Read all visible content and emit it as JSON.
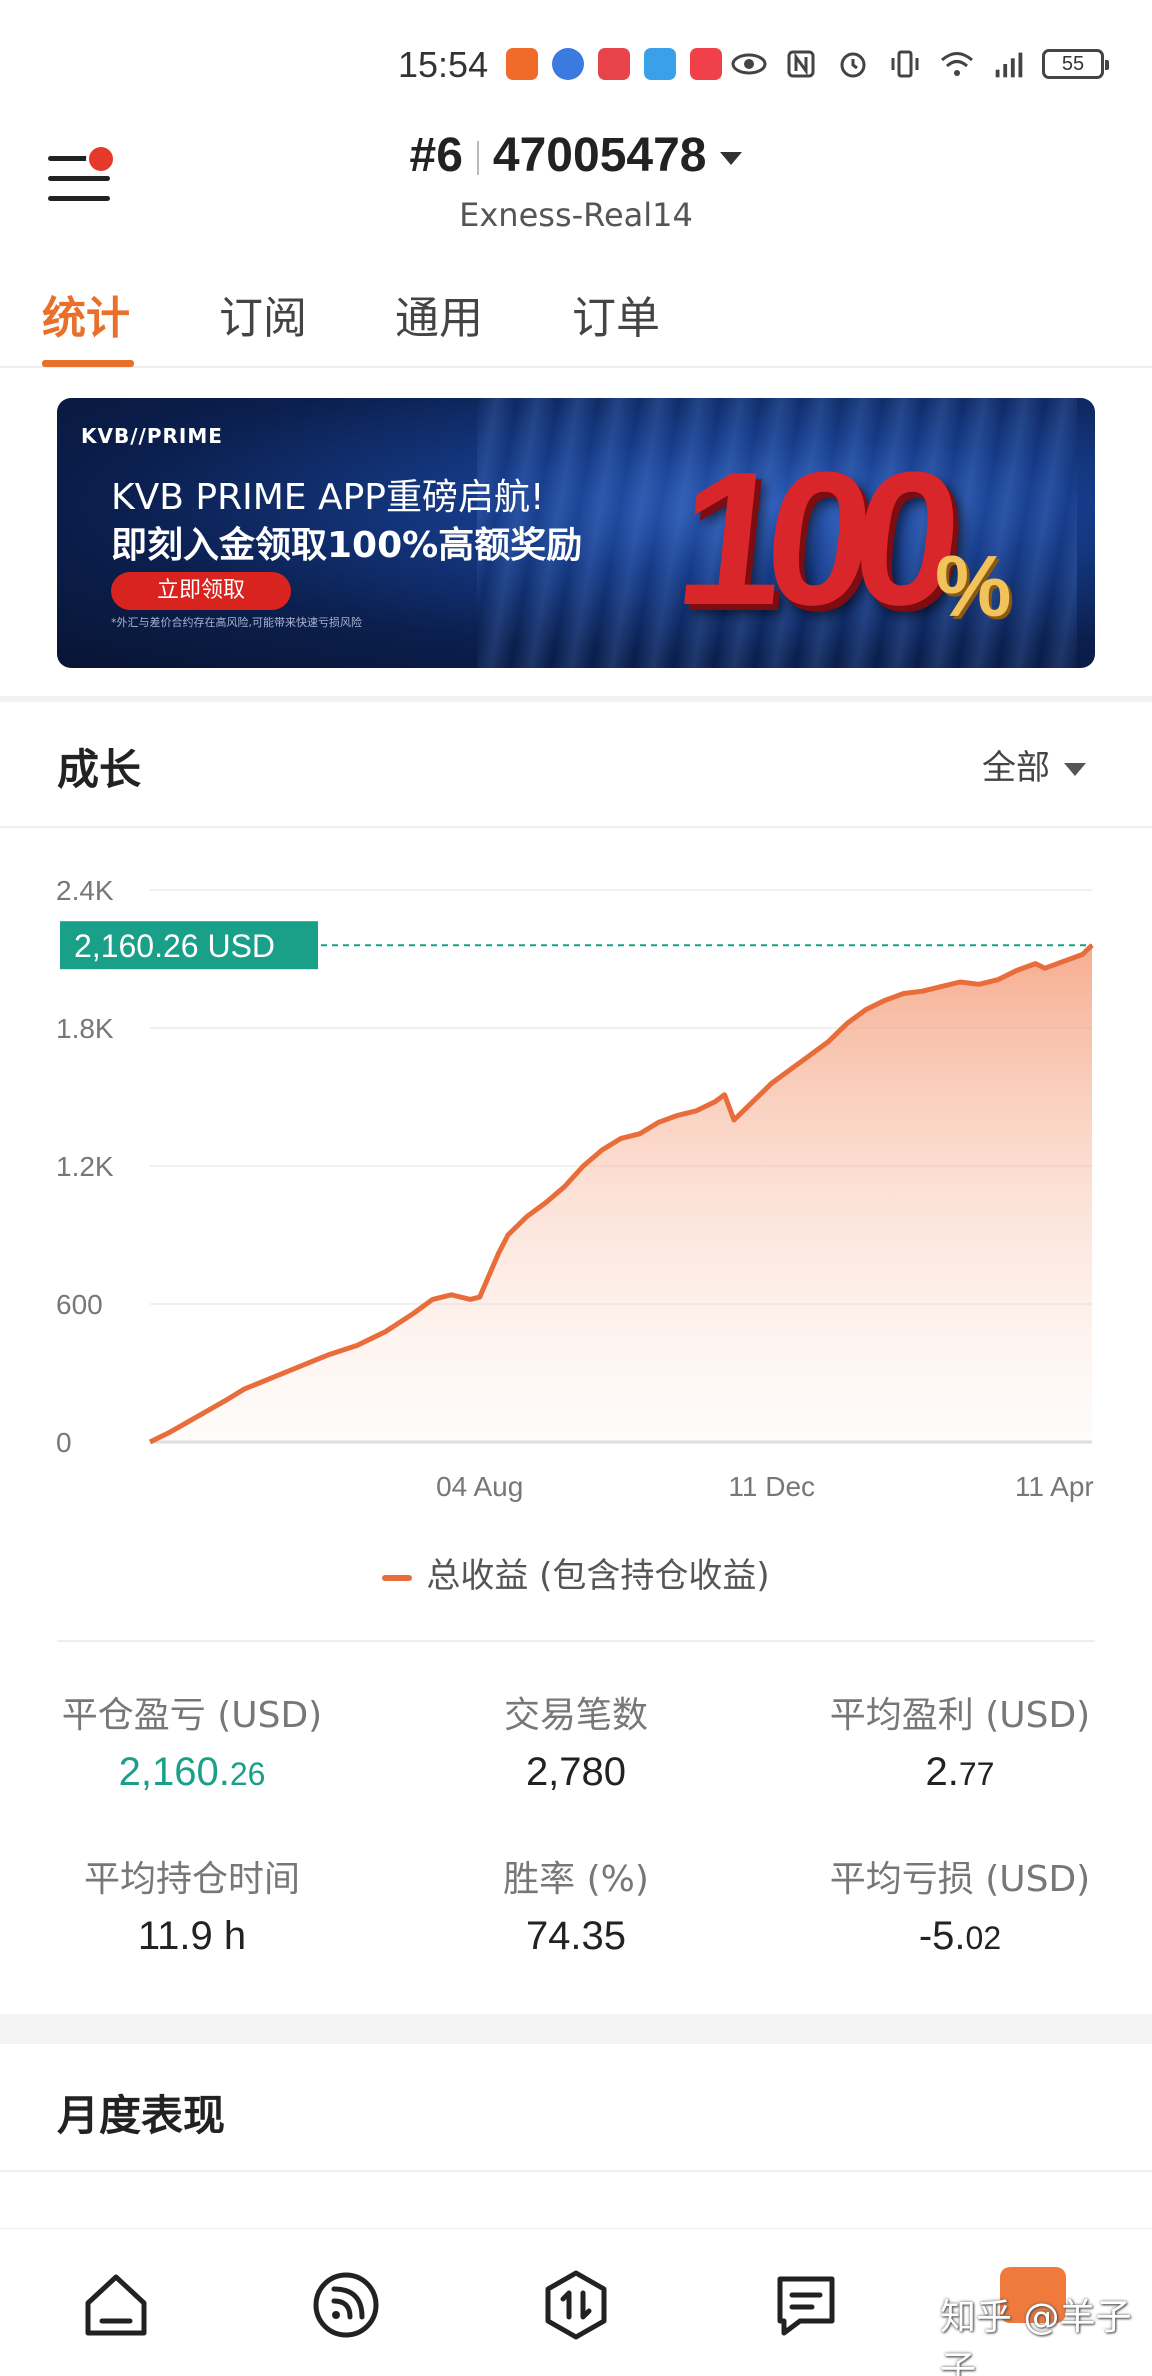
{
  "status_bar": {
    "time": "15:54",
    "battery": "55",
    "icons": [
      "app-notify-orange",
      "app-blue",
      "app-huawei",
      "app-weather",
      "app-red",
      "eye-icon",
      "nfc-icon",
      "alarm-icon",
      "vibrate-icon",
      "wifi-icon",
      "signal-5g-icon"
    ]
  },
  "header": {
    "rank": "#6",
    "account": "47005478",
    "server": "Exness-Real14"
  },
  "tabs": [
    {
      "label": "统计",
      "active": true
    },
    {
      "label": "订阅",
      "active": false
    },
    {
      "label": "通用",
      "active": false
    },
    {
      "label": "订单",
      "active": false
    }
  ],
  "banner": {
    "logo": "KVB//PRIME",
    "line1": "KVB PRIME APP重磅启航!",
    "line2": "即刻入金领取100%高额奖励",
    "cta": "立即领取",
    "disclaimer": "*外汇与差价合约存在高风险,可能带来快速亏损风险",
    "big_number": "100",
    "percent": "%"
  },
  "growth": {
    "title": "成长",
    "range_label": "全部",
    "current_value_label": "2,160.26 USD",
    "legend": "总收益 (包含持仓收益)"
  },
  "chart_data": {
    "type": "area",
    "ylim": [
      0,
      2400
    ],
    "yticks": [
      "0",
      "600",
      "1.2K",
      "1.8K",
      "2.4K"
    ],
    "ytick_values": [
      0,
      600,
      1200,
      1800,
      2400
    ],
    "xticks": [
      "04 Aug",
      "11 Dec",
      "11 Apr"
    ],
    "xtick_positions": [
      0.35,
      0.66,
      0.96
    ],
    "series": [
      {
        "name": "总收益 (包含持仓收益)",
        "color": "#e86d3a",
        "x": [
          0.0,
          0.02,
          0.05,
          0.08,
          0.1,
          0.13,
          0.16,
          0.19,
          0.22,
          0.25,
          0.28,
          0.3,
          0.32,
          0.34,
          0.35,
          0.37,
          0.38,
          0.4,
          0.42,
          0.44,
          0.46,
          0.48,
          0.5,
          0.52,
          0.54,
          0.56,
          0.58,
          0.6,
          0.61,
          0.62,
          0.64,
          0.66,
          0.68,
          0.7,
          0.72,
          0.74,
          0.76,
          0.78,
          0.8,
          0.82,
          0.84,
          0.86,
          0.88,
          0.9,
          0.92,
          0.94,
          0.95,
          0.97,
          0.99,
          1.0
        ],
        "y": [
          0,
          40,
          110,
          180,
          230,
          280,
          330,
          380,
          420,
          480,
          560,
          620,
          640,
          620,
          630,
          820,
          900,
          980,
          1040,
          1110,
          1200,
          1270,
          1320,
          1340,
          1390,
          1420,
          1440,
          1480,
          1510,
          1400,
          1480,
          1560,
          1620,
          1680,
          1740,
          1820,
          1880,
          1920,
          1950,
          1960,
          1980,
          2000,
          1990,
          2010,
          2050,
          2080,
          2060,
          2090,
          2120,
          2160
        ]
      }
    ]
  },
  "stats": [
    {
      "label": "平仓盈亏 (USD)",
      "int": "2,160.",
      "dec": "26",
      "color": "#1aa089"
    },
    {
      "label": "交易笔数",
      "int": "2,780",
      "dec": "",
      "color": "#222222"
    },
    {
      "label": "平均盈利 (USD)",
      "int": "2.",
      "dec": "77",
      "color": "#222222"
    },
    {
      "label": "平均持仓时间",
      "int": "11.9 h",
      "dec": "",
      "color": "#222222"
    },
    {
      "label": "胜率 (%)",
      "int": "74.35",
      "dec": "",
      "color": "#222222"
    },
    {
      "label": "平均亏损 (USD)",
      "int": "-5.",
      "dec": "02",
      "color": "#222222"
    }
  ],
  "monthly": {
    "title": "月度表现"
  },
  "bottom_nav": [
    "home-icon",
    "feed-icon",
    "trade-icon",
    "messages-icon",
    "profile-icon"
  ],
  "watermark": "知乎 @羊子子"
}
